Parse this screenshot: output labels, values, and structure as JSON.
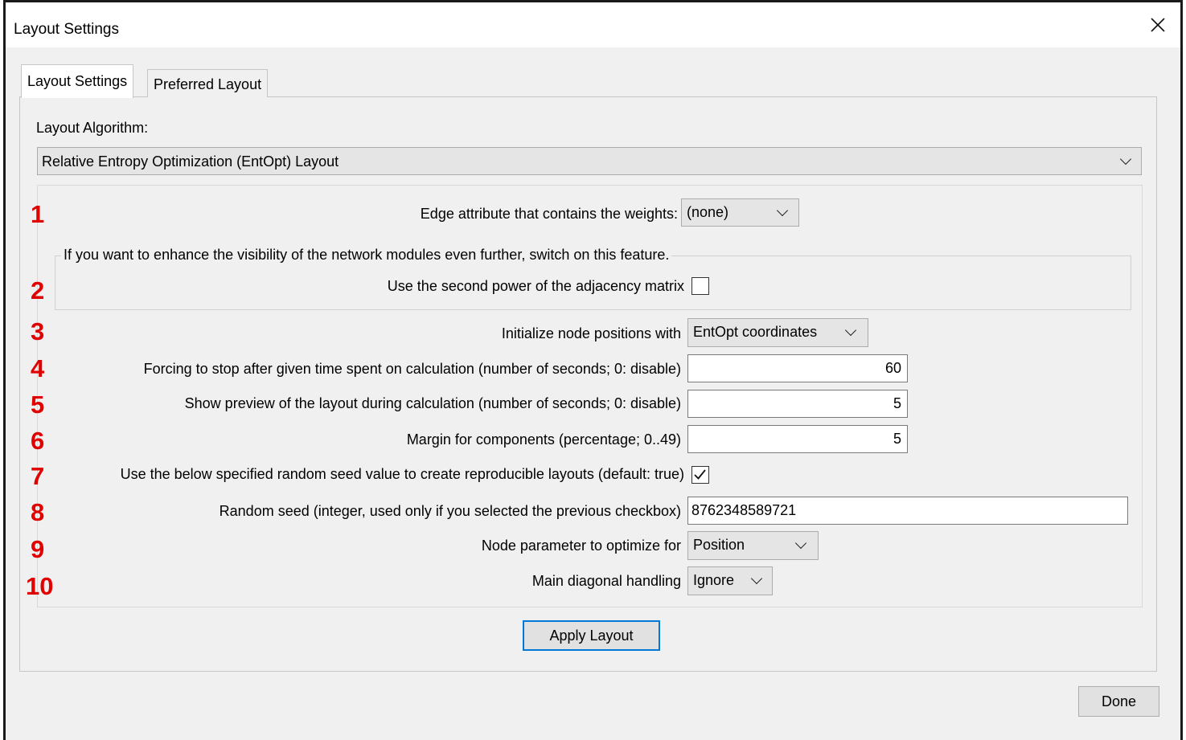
{
  "window": {
    "title": "Layout Settings"
  },
  "tabs": [
    {
      "label": "Layout Settings",
      "active": true
    },
    {
      "label": "Preferred Layout",
      "active": false
    }
  ],
  "algorithm": {
    "label": "Layout Algorithm:",
    "selected": "Relative Entropy Optimization (EntOpt) Layout"
  },
  "settings": {
    "edge_weights": {
      "number": "1",
      "label": "Edge attribute that contains the weights:",
      "value": "(none)"
    },
    "group_title": "If you want to enhance the visibility of the network modules even further, switch on this feature.",
    "second_power": {
      "number": "2",
      "label": "Use the second power of the adjacency matrix",
      "checked": false
    },
    "init_positions": {
      "number": "3",
      "label": "Initialize node positions with",
      "value": "EntOpt coordinates"
    },
    "stop_time": {
      "number": "4",
      "label": "Forcing to stop after given time spent on calculation (number of seconds; 0: disable)",
      "value": "60"
    },
    "preview": {
      "number": "5",
      "label": "Show preview of the layout during calculation (number of seconds; 0: disable)",
      "value": "5"
    },
    "margin": {
      "number": "6",
      "label": "Margin for components (percentage; 0..49)",
      "value": "5"
    },
    "use_seed": {
      "number": "7",
      "label": "Use the below specified random seed value to create reproducible layouts (default: true)",
      "checked": true
    },
    "random_seed": {
      "number": "8",
      "label": "Random seed (integer, used only if you selected the previous checkbox)",
      "value": "8762348589721"
    },
    "node_param": {
      "number": "9",
      "label": "Node parameter to optimize for",
      "value": "Position"
    },
    "main_diagonal": {
      "number": "10",
      "label": "Main diagonal handling",
      "value": "Ignore"
    }
  },
  "buttons": {
    "apply": "Apply Layout",
    "done": "Done"
  },
  "colors": {
    "annotation": "#e00000",
    "focus_border": "#0078d7"
  }
}
